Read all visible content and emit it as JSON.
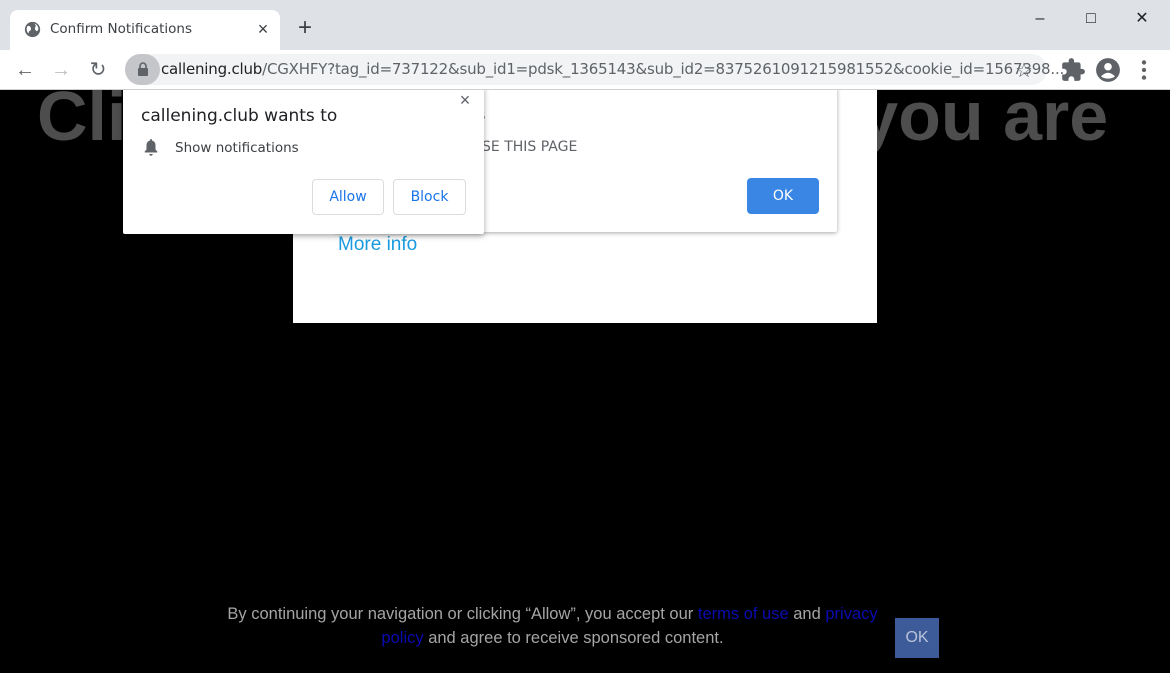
{
  "browser": {
    "tab": {
      "title": "Confirm Notifications",
      "favicon": "globe-icon",
      "close_label": "×"
    },
    "new_tab_label": "+",
    "window_controls": {
      "minimize": "–",
      "maximize": "□",
      "close": "✕"
    },
    "nav": {
      "back": "←",
      "forward": "→",
      "reload": "↻"
    },
    "url": {
      "host": "callening.club",
      "path": "/CGXHFY?tag_id=737122&sub_id1=pdsk_1365143&sub_id2=8375261091215981552&cookie_id=1567398..."
    },
    "toolbar_icons": [
      "star-icon",
      "extensions-icon",
      "profile-icon",
      "menu-icon"
    ]
  },
  "page": {
    "headline": "Click Allow if you confirm that you are",
    "headline_visible_left": "Cli",
    "headline_visible_right": "t you are",
    "more_info": "More info",
    "alert": {
      "title_fragment": "s",
      "message_fragment": "OSE THIS PAGE",
      "ok_label": "OK",
      "ok_color": "#3a86e4"
    },
    "consent": {
      "text_before": "By continuing your navigation or clicking “Allow”, you accept our ",
      "terms_link": "terms of use",
      "text_mid": " and ",
      "privacy_link": "privacy policy",
      "text_after": " and agree to receive sponsored content.",
      "ok_label": "OK"
    }
  },
  "permission_prompt": {
    "title": "callening.club wants to",
    "permission": "Show notifications",
    "permission_icon": "bell-icon",
    "allow_label": "Allow",
    "block_label": "Block",
    "close_label": "×",
    "accent": "#1a73e8"
  }
}
